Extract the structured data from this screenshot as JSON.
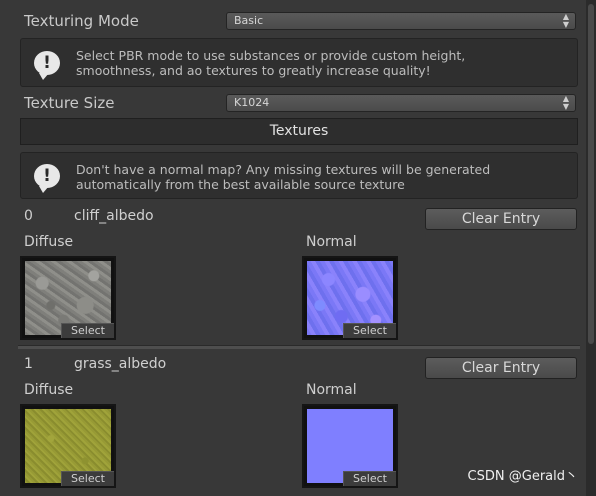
{
  "texturing_mode": {
    "label": "Texturing Mode",
    "value": "Basic"
  },
  "pbr_help": {
    "message": "Select PBR mode to use substances or provide custom height, smoothness, and ao textures to greatly increase quality!"
  },
  "texture_size": {
    "label": "Texture Size",
    "value": "K1024"
  },
  "textures_header": "Textures",
  "normal_help": {
    "message": "Don't have a normal map? Any missing textures will be generated automatically from the best available source texture"
  },
  "entries": [
    {
      "index": "0",
      "name": "cliff_albedo",
      "clear_label": "Clear Entry",
      "diffuse_label": "Diffuse",
      "normal_label": "Normal",
      "select_label": "Select"
    },
    {
      "index": "1",
      "name": "grass_albedo",
      "clear_label": "Clear Entry",
      "diffuse_label": "Diffuse",
      "normal_label": "Normal",
      "select_label": "Select"
    }
  ],
  "watermark": "CSDN @Gerald丶",
  "colors": {
    "background": "#383838",
    "panel": "#2f2f2f",
    "normal_map": "#7f7fff"
  },
  "icons": {
    "info": "info-icon",
    "dropdown": "dropdown-arrows-icon"
  }
}
